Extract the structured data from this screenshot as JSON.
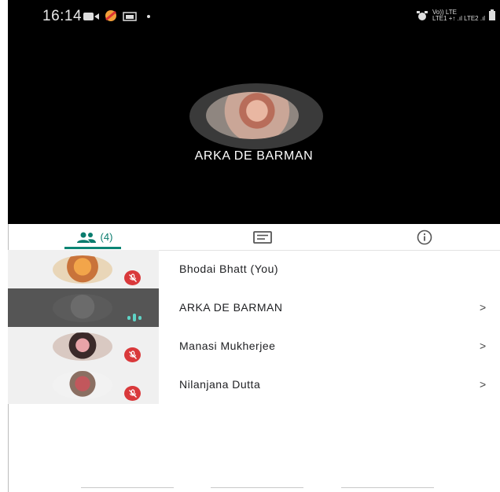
{
  "status_bar": {
    "time": "16:14",
    "net_line1": "Vo)) LTE",
    "net_line2": "LTE1 +↑ .ıl LTE2 .ıl"
  },
  "active_speaker": {
    "name": "ARKA DE BARMAN"
  },
  "tabs": {
    "people_count": "(4)",
    "chat_icon": "chat-icon",
    "info_icon": "info-icon"
  },
  "participants": [
    {
      "name": "Bhodai Bhatt (You)",
      "muted": true,
      "chevron": ""
    },
    {
      "name": "ARKA DE BARMAN",
      "muted": false,
      "speaking": true,
      "chevron": ">"
    },
    {
      "name": "Manasi Mukherjee",
      "muted": true,
      "chevron": ">"
    },
    {
      "name": "Nilanjana Dutta",
      "muted": true,
      "chevron": ">"
    }
  ],
  "colors": {
    "accent": "#0b8574",
    "mute": "#d9393b",
    "speaking": "#5fd3c6"
  }
}
